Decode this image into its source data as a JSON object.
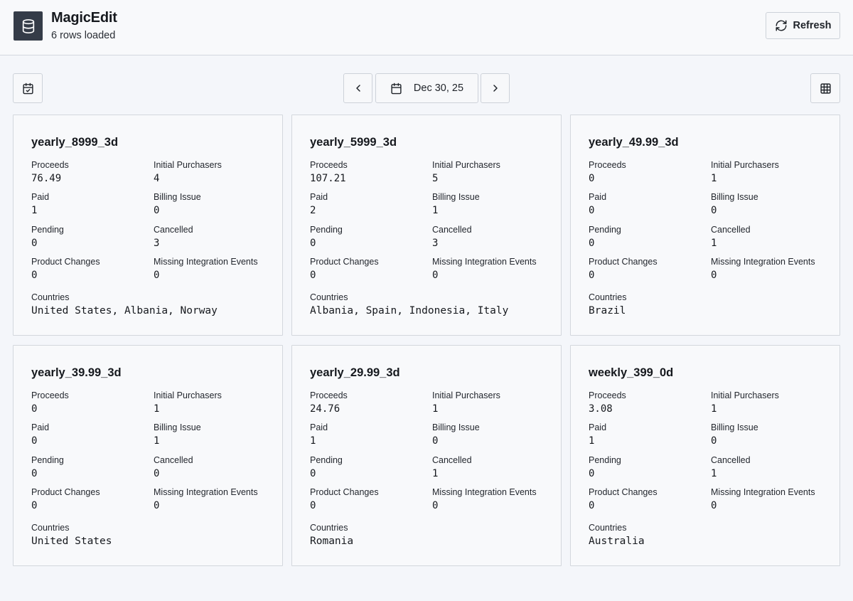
{
  "header": {
    "title": "MagicEdit",
    "subtitle": "6 rows loaded",
    "refresh_label": "Refresh"
  },
  "toolbar": {
    "date_label": "Dec 30, 25"
  },
  "labels": {
    "proceeds": "Proceeds",
    "initial_purchasers": "Initial Purchasers",
    "paid": "Paid",
    "billing_issue": "Billing Issue",
    "pending": "Pending",
    "cancelled": "Cancelled",
    "product_changes": "Product Changes",
    "missing_integration_events": "Missing Integration Events",
    "countries": "Countries"
  },
  "cards": [
    {
      "title": "yearly_8999_3d",
      "proceeds": "76.49",
      "initial_purchasers": "4",
      "paid": "1",
      "billing_issue": "0",
      "pending": "0",
      "cancelled": "3",
      "product_changes": "0",
      "missing_integration_events": "0",
      "countries": "United States, Albania, Norway"
    },
    {
      "title": "yearly_5999_3d",
      "proceeds": "107.21",
      "initial_purchasers": "5",
      "paid": "2",
      "billing_issue": "1",
      "pending": "0",
      "cancelled": "3",
      "product_changes": "0",
      "missing_integration_events": "0",
      "countries": "Albania, Spain, Indonesia, Italy"
    },
    {
      "title": "yearly_49.99_3d",
      "proceeds": "0",
      "initial_purchasers": "1",
      "paid": "0",
      "billing_issue": "0",
      "pending": "0",
      "cancelled": "1",
      "product_changes": "0",
      "missing_integration_events": "0",
      "countries": "Brazil"
    },
    {
      "title": "yearly_39.99_3d",
      "proceeds": "0",
      "initial_purchasers": "1",
      "paid": "0",
      "billing_issue": "1",
      "pending": "0",
      "cancelled": "0",
      "product_changes": "0",
      "missing_integration_events": "0",
      "countries": "United States"
    },
    {
      "title": "yearly_29.99_3d",
      "proceeds": "24.76",
      "initial_purchasers": "1",
      "paid": "1",
      "billing_issue": "0",
      "pending": "0",
      "cancelled": "1",
      "product_changes": "0",
      "missing_integration_events": "0",
      "countries": "Romania"
    },
    {
      "title": "weekly_399_0d",
      "proceeds": "3.08",
      "initial_purchasers": "1",
      "paid": "1",
      "billing_issue": "0",
      "pending": "0",
      "cancelled": "1",
      "product_changes": "0",
      "missing_integration_events": "0",
      "countries": "Australia"
    }
  ],
  "icons": {
    "logo": "database-icon",
    "refresh": "refresh-icon",
    "today": "calendar-check-icon",
    "prev": "chevron-left-icon",
    "date": "calendar-icon",
    "next": "chevron-right-icon",
    "view": "table-icon"
  },
  "colors": {
    "background": "#f4f6fa",
    "logo_bg": "#353c48",
    "border": "#d3d7dd"
  }
}
